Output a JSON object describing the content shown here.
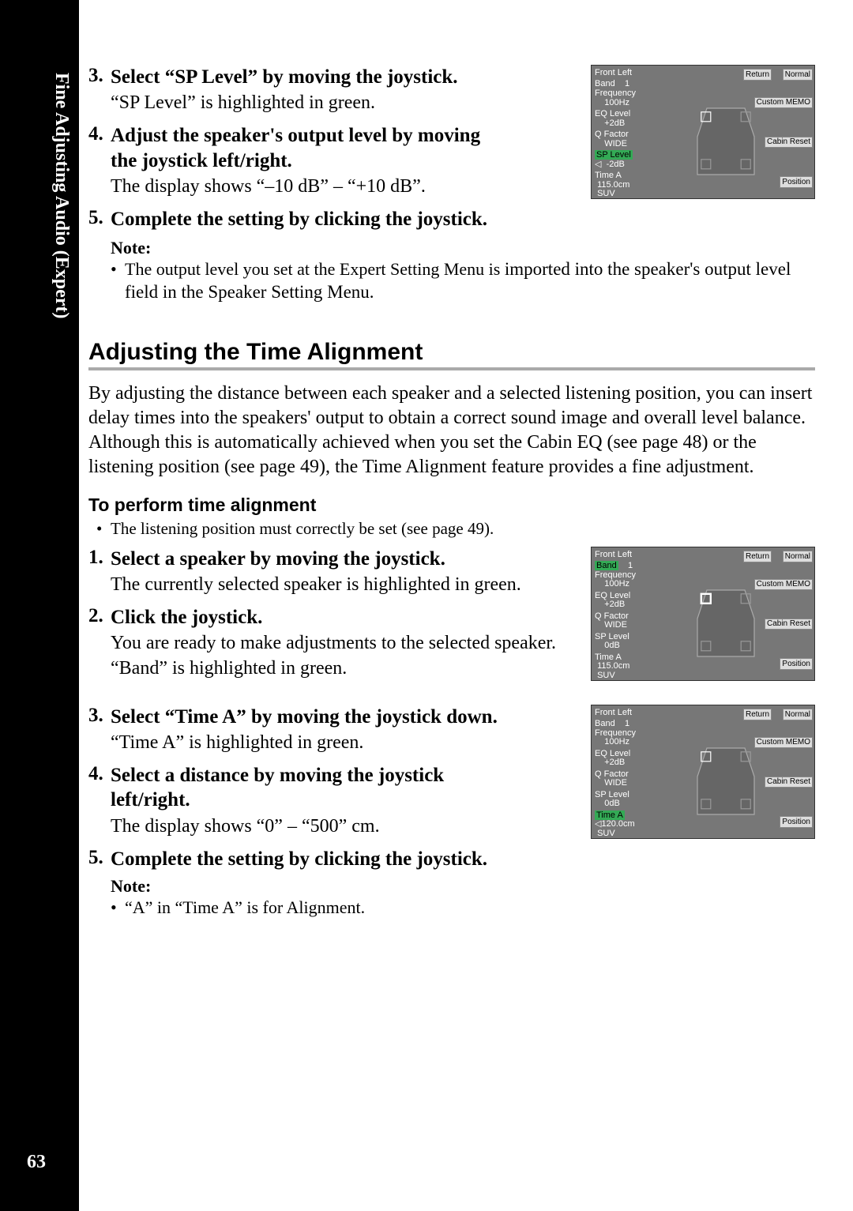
{
  "side_title": "Fine Adjusting Audio (Expert)",
  "page_number": "63",
  "top": {
    "step3_title": "Select “SP Level” by moving the joystick.",
    "step3_desc": "“SP Level” is highlighted in green.",
    "step4_title_l1": "Adjust the speaker's output level by moving",
    "step4_title_l2": "the joystick left/right.",
    "step4_desc": "The display shows “–10 dB” – “+10 dB”.",
    "step5_title": "Complete the setting by clicking the joystick.",
    "note_label": "Note:",
    "note_text_a": "The output level you set at the Expert Setting Menu is ",
    "note_text_b": "imported into the speaker's output level field in the Speaker Setting Menu."
  },
  "section_title": "Adjusting the Time Alignment",
  "intro": "By adjusting the distance between each speaker and a selected listening position, you can insert delay times into the speakers' output to obtain a correct sound image and overall level balance. Although this is automatically achieved when you set the Cabin EQ (see page 48) or the listening position (see page 49), the Time Alignment feature provides a fine adjustment.",
  "sub_title": "To perform time alignment",
  "prereq": "The listening position must correctly be set (see page 49).",
  "bottom": {
    "step1_title": "Select a speaker by moving the joystick.",
    "step1_desc": "The currently selected speaker is highlighted in green.",
    "step2_title": "Click the joystick.",
    "step2_desc": "You are ready to make adjustments to the selected speaker. “Band” is highlighted in green.",
    "step3_title": "Select “Time A” by moving the joystick down.",
    "step3_desc": "“Time A” is highlighted in green.",
    "step4_title_l1": "Select a distance by moving the joystick",
    "step4_title_l2": "left/right.",
    "step4_desc": "The display shows “0” – “500” cm.",
    "step5_title": "Complete the setting by clicking the joystick.",
    "note_label": "Note:",
    "note_text": "“A” in “Time A” is for Alignment."
  },
  "screen": {
    "front_left": "Front Left",
    "band": "Band",
    "band_val": "1",
    "frequency": "Frequency",
    "freq_val": "100Hz",
    "eq_level": "EQ Level",
    "eq_val": "+2dB",
    "q_factor": "Q Factor",
    "q_val": "WIDE",
    "sp_level": "SP Level",
    "sp_val": "-2dB",
    "sp_val2": "0dB",
    "time_a": "Time A",
    "time_val": "115.0cm",
    "time_val2": "120.0cm",
    "suv": "SUV",
    "btn_return": "Return",
    "btn_normal": "Normal",
    "btn_custom": "Custom MEMO",
    "btn_cabin": "Cabin Reset",
    "btn_position": "Position"
  }
}
